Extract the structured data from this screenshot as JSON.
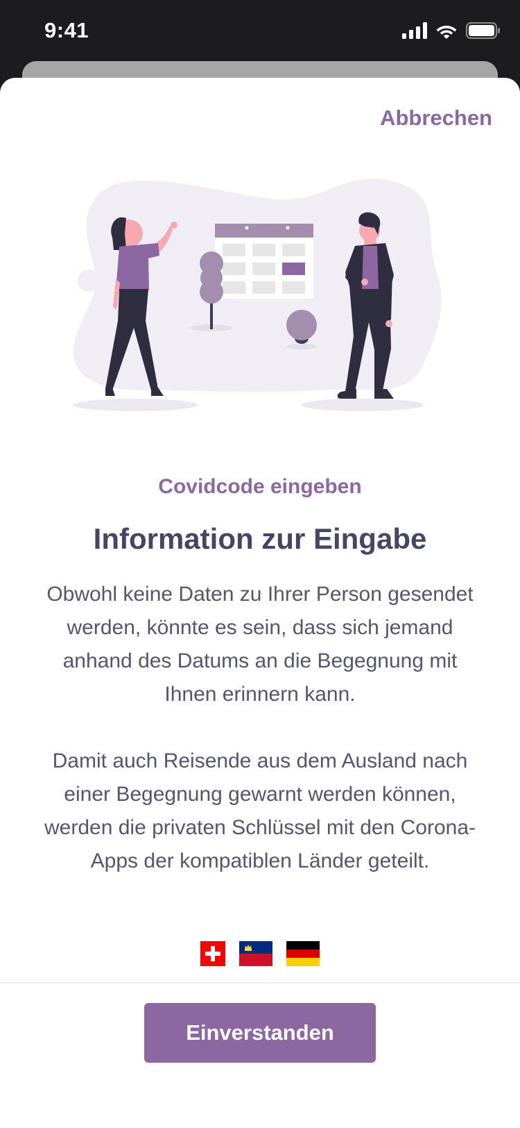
{
  "status_bar": {
    "time": "9:41"
  },
  "header": {
    "cancel_label": "Abbrechen"
  },
  "content": {
    "subtitle": "Covidcode eingeben",
    "title": "Information zur Eingabe",
    "paragraph1": "Obwohl keine Daten zu Ihrer Person gesendet werden, könnte es sein, dass sich jemand anhand des Datums an die Begegnung mit Ihnen erinnern kann.",
    "paragraph2": "Damit auch Reisende aus dem Ausland nach einer Begegnung gewarnt werden können, werden die privaten Schlüssel mit den Corona-Apps der kompatiblen Länder geteilt."
  },
  "flags": [
    "switzerland-flag",
    "liechtenstein-flag",
    "germany-flag"
  ],
  "footer": {
    "button_label": "Einverstanden"
  },
  "colors": {
    "accent": "#8c67a0",
    "title": "#454565",
    "body": "#55556f"
  }
}
